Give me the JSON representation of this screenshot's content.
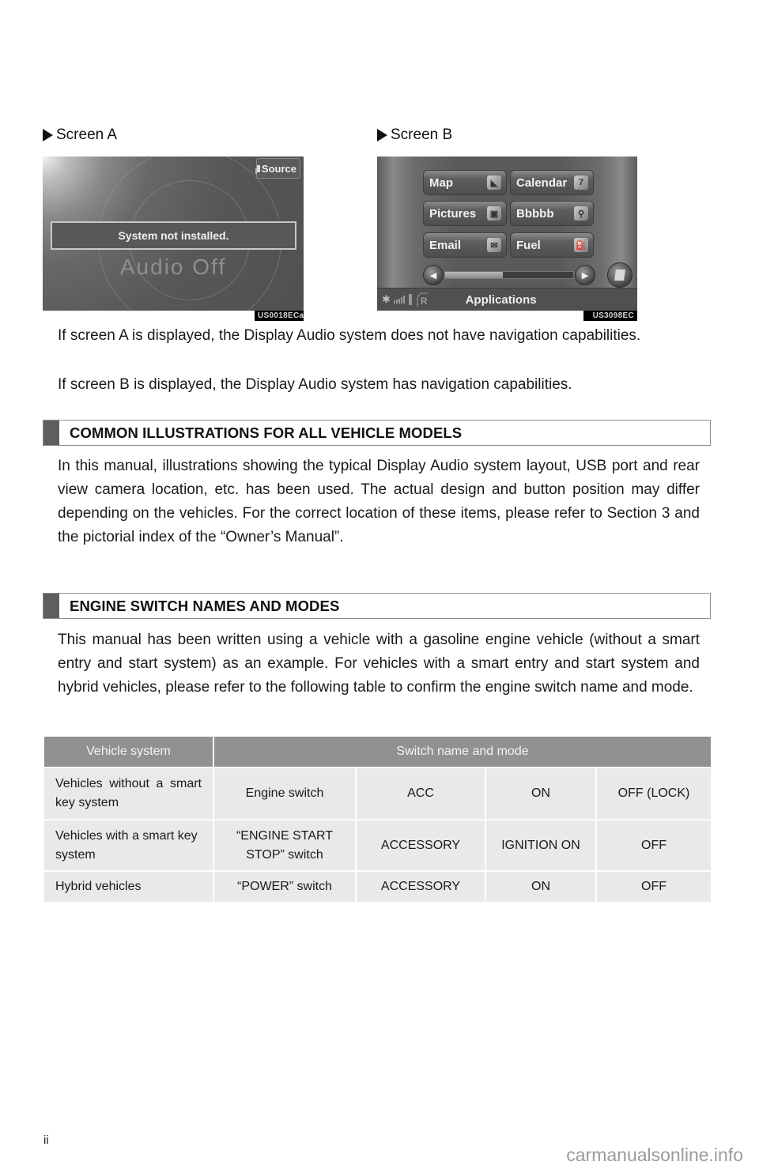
{
  "screen_a": {
    "label": "Screen A",
    "source_button": "Source",
    "message": "System not installed.",
    "status_text": "Audio Off",
    "figure_code": "US0018ECa"
  },
  "screen_b": {
    "label": "Screen B",
    "apps": [
      {
        "label": "Map",
        "icon": "map-icon",
        "glyph": "◣"
      },
      {
        "label": "Calendar",
        "icon": "calendar-icon",
        "glyph": "7"
      },
      {
        "label": "Pictures",
        "icon": "pictures-icon",
        "glyph": "▣"
      },
      {
        "label": "Bbbbb",
        "icon": "search-icon",
        "glyph": "⚲"
      },
      {
        "label": "Email",
        "icon": "email-icon",
        "glyph": "✉"
      },
      {
        "label": "Fuel",
        "icon": "fuel-icon",
        "glyph": "⛽"
      }
    ],
    "scroll_left_glyph": "◀",
    "scroll_right_glyph": "▶",
    "scroll_position": 0.45,
    "bluetooth_glyph": "✱",
    "roaming_label": "R",
    "status_title": "Applications",
    "figure_code": "US3098EC"
  },
  "intro": {
    "para_a": "If screen A is displayed, the Display Audio system does not have navigation capabilities.",
    "para_b": "If screen B is displayed, the Display Audio system has navigation capabilities."
  },
  "section_common": {
    "heading": "COMMON ILLUSTRATIONS FOR ALL VEHICLE MODELS",
    "body": "In this manual, illustrations showing the typical Display Audio system layout, USB port and rear view camera location, etc. has been used. The actual design and button position may differ depending on the vehicles. For the correct location of these items, please refer to Section 3 and the pictorial index of the “Owner’s Manual”."
  },
  "section_engine": {
    "heading": "ENGINE SWITCH NAMES AND MODES",
    "body": "This manual has been written using a vehicle with a gasoline engine vehicle (without a smart entry and start system) as an example. For vehicles with a smart entry and start system and hybrid vehicles, please refer to the following table to confirm the engine switch name and mode."
  },
  "table": {
    "headers": [
      "Vehicle system",
      "Switch name and mode"
    ],
    "rows": [
      [
        "Vehicles without a smart key system",
        "Engine switch",
        "ACC",
        "ON",
        "OFF (LOCK)"
      ],
      [
        "Vehicles with a smart key system",
        "“ENGINE START STOP” switch",
        "ACCESSORY",
        "IGNITION ON",
        "OFF"
      ],
      [
        "Hybrid vehicles",
        "“POWER” switch",
        "ACCESSORY",
        "ON",
        "OFF"
      ]
    ]
  },
  "footer": {
    "page_number": "ii",
    "watermark": "carmanualsonline.info"
  }
}
